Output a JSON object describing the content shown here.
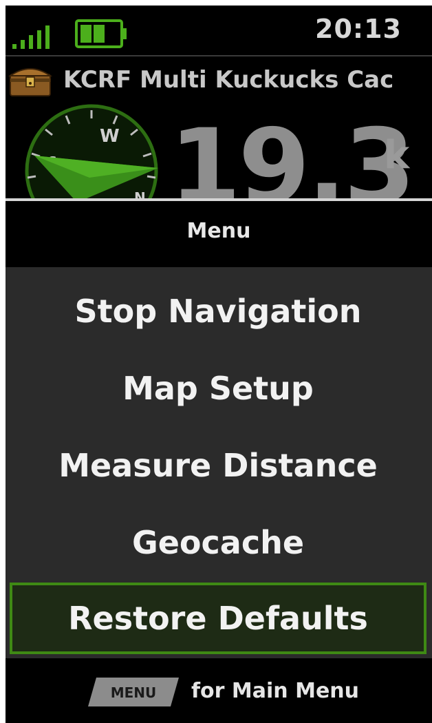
{
  "status": {
    "time": "20:13",
    "signal_icon": "signal-bars-icon",
    "battery_icon": "battery-icon"
  },
  "cache": {
    "name": "KCRF Multi  Kuckucks Cac",
    "icon": "treasure-chest-icon"
  },
  "navigation": {
    "compass_icon": "compass-icon",
    "compass_letters": [
      "W",
      "S",
      "N"
    ],
    "distance": "19.3",
    "distance_unit": "k",
    "accent_color": "#3a8f1a"
  },
  "menu": {
    "title": "Menu",
    "items": [
      {
        "label": "Stop Navigation",
        "selected": false
      },
      {
        "label": "Map Setup",
        "selected": false
      },
      {
        "label": "Measure Distance",
        "selected": false
      },
      {
        "label": "Geocache",
        "selected": false
      },
      {
        "label": "Restore Defaults",
        "selected": true
      }
    ],
    "selection_color": "#3f8a14"
  },
  "footer": {
    "key_label": "MENU",
    "text": "for Main Menu"
  }
}
